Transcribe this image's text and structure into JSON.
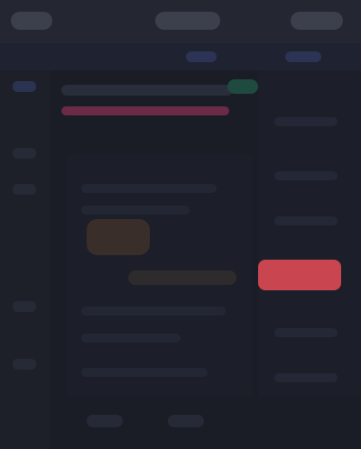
{
  "theme": {
    "background": "#1b1e28",
    "accent_danger": "#c9454f",
    "accent_pink": "#6b2a45",
    "accent_green": "#1f4a40"
  },
  "topbar": {
    "chips": [
      "",
      "",
      ""
    ]
  },
  "icons": {
    "menu": "menu-icon",
    "user": "user-icon"
  },
  "main": {
    "title": "",
    "subtitle": ""
  },
  "right": {
    "danger_button_label": ""
  }
}
